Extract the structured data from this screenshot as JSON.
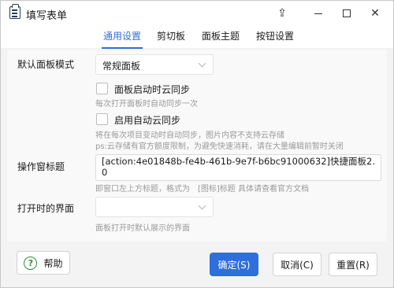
{
  "window": {
    "title": "填写表单",
    "pin_glyph": "⇪",
    "close_glyph": "✕"
  },
  "tabs": [
    {
      "label": "通用设置",
      "active": true
    },
    {
      "label": "剪切板",
      "active": false
    },
    {
      "label": "面板主题",
      "active": false
    },
    {
      "label": "按钮设置",
      "active": false
    }
  ],
  "form": {
    "panel_mode": {
      "label": "默认面板模式",
      "value": "常规面板"
    },
    "cloud_sync_on_start": {
      "label": "面板启动时云同步",
      "checked": false,
      "hint": "每次打开面板时自动同步一次"
    },
    "auto_cloud_sync": {
      "label": "启用自动云同步",
      "checked": false,
      "hint_line1": "将在每次项目变动时自动同步，图片内容不支持云存储",
      "hint_line2": "ps:云存储有官方额度限制，为避免快速消耗，请在大量编辑前暂时关闭"
    },
    "window_title": {
      "label": "操作窗标题",
      "value": "[action:4e01848b-fe4b-461b-9e7f-b6bc91000632]快捷面板2.0",
      "hint": "即窗口左上方标题，格式为　[图标]标题 具体请查看官方文档"
    },
    "open_view": {
      "label": "打开时的界面",
      "value": "",
      "hint": "面板打开时默认展示的界面"
    }
  },
  "footer": {
    "help_label": "帮助",
    "help_glyph": "?",
    "ok_label": "确定(S)",
    "cancel_label": "取消(C)",
    "reset_label": "重置(R)"
  },
  "colors": {
    "accent": "#2f6fdc",
    "help_green": "#2e8b3a"
  }
}
